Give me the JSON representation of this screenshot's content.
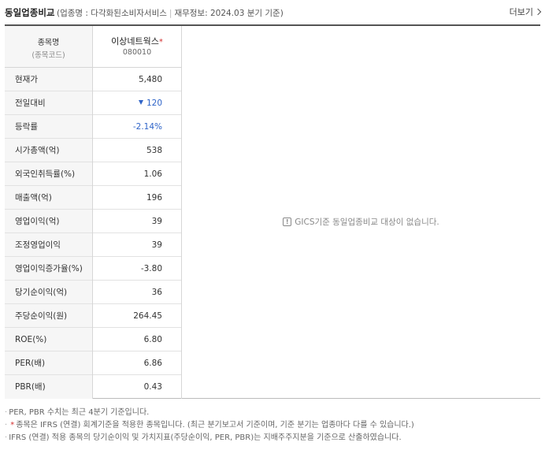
{
  "header": {
    "title": "동일업종비교",
    "industry_label": "업종명 : 다각화된소비자서비스",
    "fin_info": "재무정보: 2024.03 분기 기준",
    "paren_open": "(",
    "paren_close": ")",
    "more_label": "더보기"
  },
  "table": {
    "label_header": "종목명",
    "label_subheader": "(종목코드)",
    "stock_name": "이상네트웍스",
    "stock_star": "*",
    "stock_code": "080010",
    "rows": [
      {
        "label": "현재가",
        "value": "5,480"
      },
      {
        "label": "전일대비",
        "value": "120",
        "direction": "down"
      },
      {
        "label": "등락률",
        "value": "-2.14%"
      },
      {
        "label": "시가총액(억)",
        "value": "538"
      },
      {
        "label": "외국인취득률(%)",
        "value": "1.06"
      },
      {
        "label": "매출액(억)",
        "value": "196"
      },
      {
        "label": "영업이익(억)",
        "value": "39"
      },
      {
        "label": "조정영업이익",
        "value": "39"
      },
      {
        "label": "영업이익증가율(%)",
        "value": "-3.80"
      },
      {
        "label": "당기순이익(억)",
        "value": "36"
      },
      {
        "label": "주당순이익(원)",
        "value": "264.45"
      },
      {
        "label": "ROE(%)",
        "value": "6.80"
      },
      {
        "label": "PER(배)",
        "value": "6.86"
      },
      {
        "label": "PBR(배)",
        "value": "0.43"
      }
    ],
    "empty_message": "GICS기준 동일업종비교 대상이 없습니다."
  },
  "notes": {
    "note1": "PER, PBR 수치는 최근 4분기 기준입니다.",
    "note2_star": "*",
    "note2": "종목은 IFRS (연결) 회계기준을 적용한 종목입니다. (최근 분기보고서 기준이며, 기준 분기는 업종마다 다를 수 있습니다.)",
    "note3": "IFRS (연결) 적용 종목의 당기순이익 및 가치지표(주당순이익, PER, PBR)는 지배주주지분을 기준으로 산출하였습니다."
  },
  "colors": {
    "down": "#2f64c8",
    "star": "#d32f2f"
  },
  "icons": {
    "more": "chevron-right-icon",
    "down": "triangle-down-icon",
    "notice": "exclamation-box-icon"
  }
}
